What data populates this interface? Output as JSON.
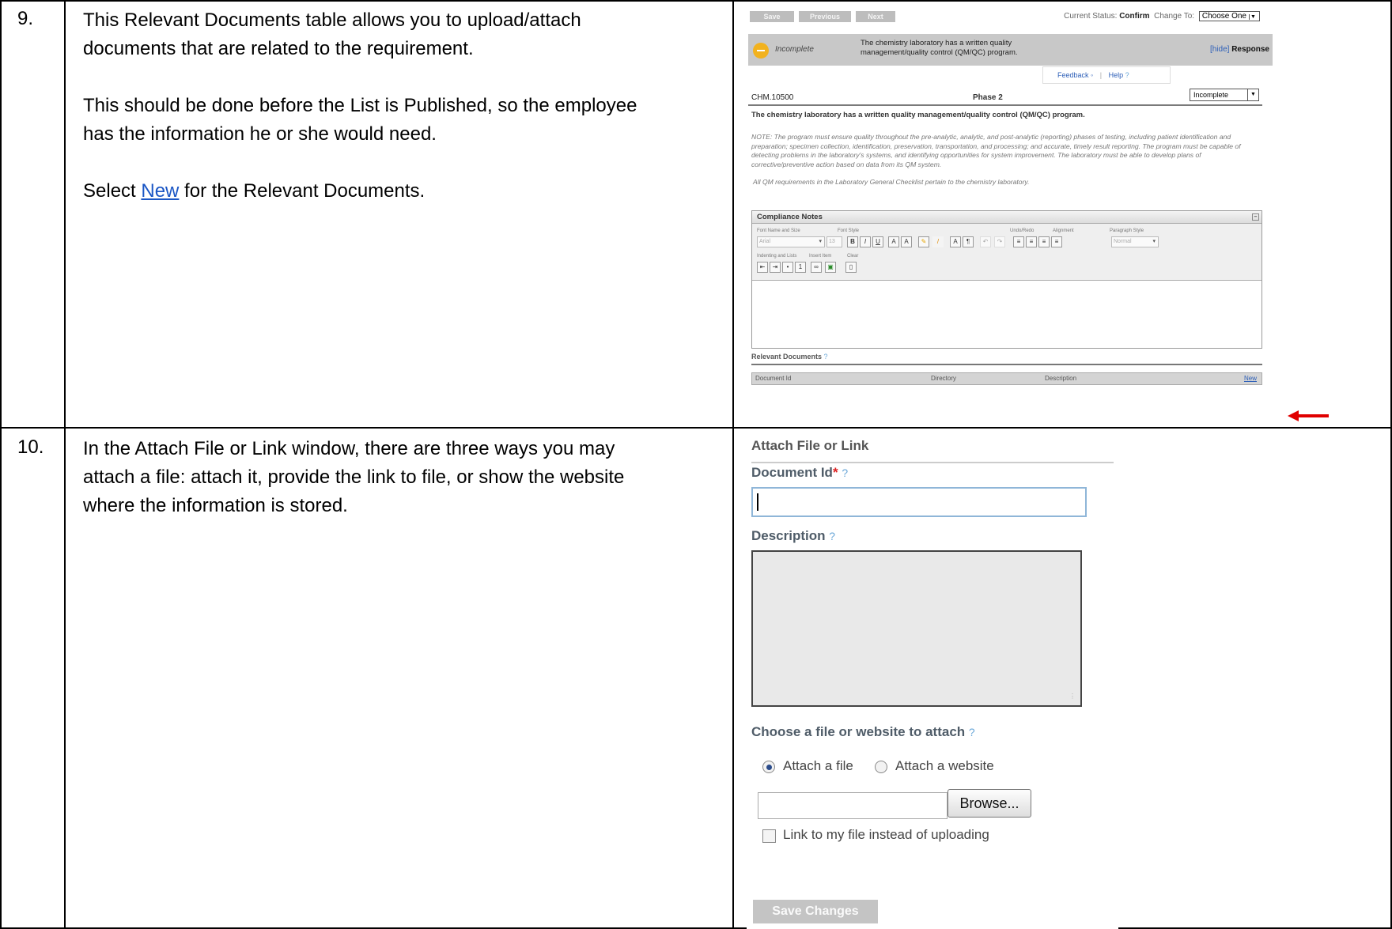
{
  "steps": [
    {
      "number": "9.",
      "line1": "This Relevant Documents table allows you to upload/attach",
      "line2": "documents that are related to the requirement.",
      "line3": "This should be done before the List is Published, so the employee",
      "line4": "has the information he or she would need.",
      "line5_prefix": "Select ",
      "line5_link": "New",
      "line5_suffix": " for the Relevant Documents."
    },
    {
      "number": "10.",
      "line1": "In the Attach File or Link window, there are three ways you may",
      "line2": "attach a file:  attach it, provide the link to file, or show the website",
      "line3": "where the information is stored."
    }
  ],
  "editor": {
    "toolbar_buttons": [
      "Save",
      "Previous",
      "Next"
    ],
    "current_status_label": "Current Status:",
    "current_status_value": "Confirm",
    "change_to_label": "Change To:",
    "change_to_value": "Choose One",
    "status_word": "Incomplete",
    "header_text": "The chemistry laboratory has a written quality management/quality control (QM/QC) program.",
    "hide_label": "[hide]",
    "response_label": "Response",
    "feedback_label": "Feedback",
    "help_label": "Help",
    "requirement_id": "CHM.10500",
    "phase": "Phase 2",
    "status_select": "Incomplete",
    "requirement_text": "The chemistry laboratory has a written quality management/quality control (QM/QC) program.",
    "note_text": "NOTE:  The program must ensure quality throughout the pre-analytic, analytic, and post-analytic (reporting) phases of testing, including patient identification and preparation; specimen collection, identification, preservation, transportation, and processing; and accurate, timely result reporting.  The program must be capable of detecting problems in the laboratory's systems, and identifying opportunities for system improvement.  The laboratory must be able to develop plans of corrective/preventive action based on data from its QM system.",
    "note2_text": "All QM requirements in the Laboratory General Checklist pertain to the chemistry laboratory.",
    "compliance_notes_label": "Compliance Notes",
    "toolbar_groups": {
      "font_name_size": "Font Name and Size",
      "font_style": "Font Style",
      "undo_redo": "Undo/Redo",
      "alignment": "Alignment",
      "paragraph_style": "Paragraph Style",
      "indenting_lists": "Indenting and Lists",
      "insert_item": "Insert Item",
      "clear": "Clear"
    },
    "font_name_value": "Arial",
    "font_size_value": "13",
    "paragraph_style_value": "Normal",
    "relevant_documents_label": "Relevant Documents",
    "columns": [
      "Document Id",
      "Directory",
      "Description"
    ],
    "new_link": "New"
  },
  "dialog": {
    "title": "Attach File or Link",
    "document_id_label": "Document Id",
    "required_mark": "*",
    "help_mark": "?",
    "description_label": "Description",
    "choose_label": "Choose a file or website to attach",
    "radio_file": "Attach a file",
    "radio_website": "Attach a website",
    "radio_selected": "Attach a file",
    "browse_label": "Browse...",
    "link_checkbox_label": "Link to my file instead of uploading",
    "link_checkbox_checked": false,
    "save_label": "Save Changes"
  },
  "colors": {
    "link_blue": "#1a56c5",
    "arrow_red": "#e00000",
    "status_yellow": "#f2b21e"
  }
}
